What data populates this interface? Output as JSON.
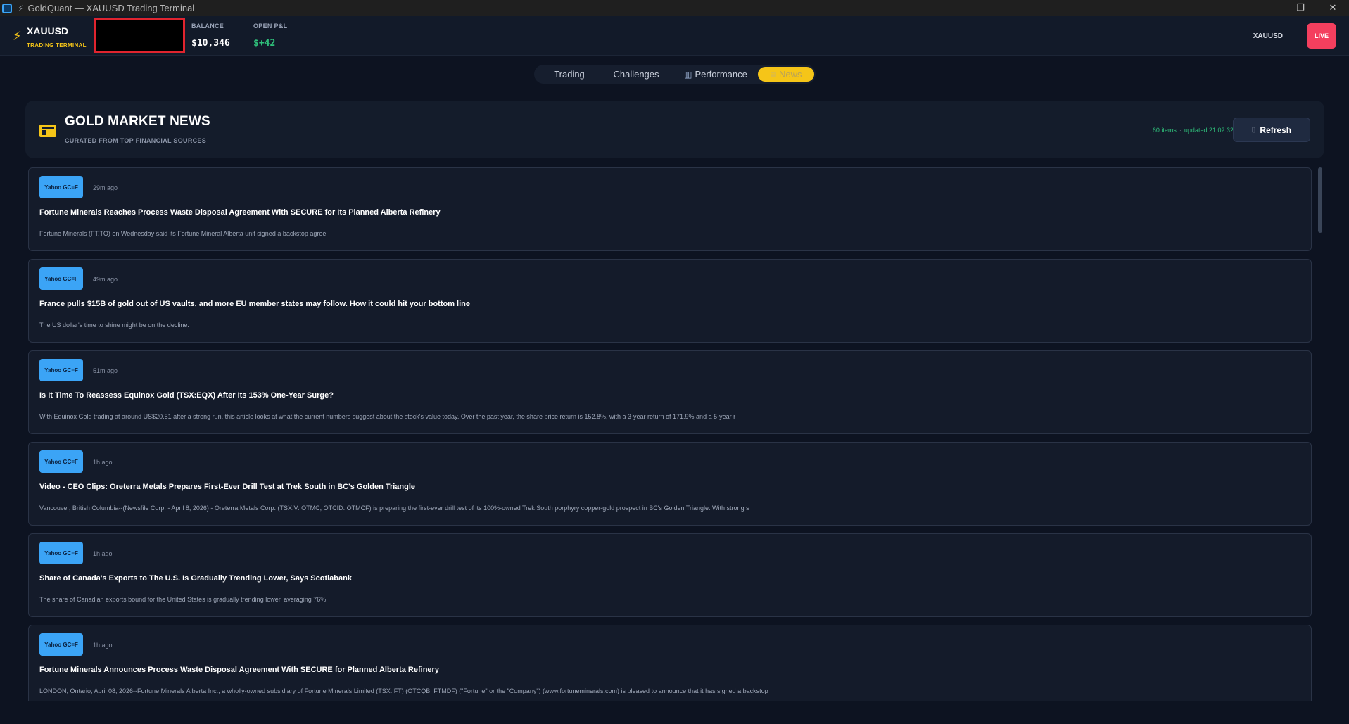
{
  "window": {
    "title": "GoldQuant — XAUUSD Trading Terminal",
    "controls": [
      "—",
      "❐",
      "✕"
    ]
  },
  "header": {
    "symbol": "XAUUSD",
    "subtitle": "TRADING TERMINAL",
    "balance_label": "BALANCE",
    "balance_value": "$10,346",
    "pnl_label": "OPEN P&L",
    "pnl_value": "$+42",
    "right_symbol": "XAUUSD",
    "live_label": "LIVE",
    "colors": {
      "accent": "#f5c518",
      "positive": "#2fbf7a",
      "live": "#f43f5e"
    }
  },
  "tabs": [
    {
      "label": "Trading",
      "icon": ""
    },
    {
      "label": "Challenges",
      "icon": ""
    },
    {
      "label": "Performance",
      "icon": "bar-chart-icon"
    },
    {
      "label": "News",
      "icon": "newspaper-icon",
      "active": true
    }
  ],
  "news_panel": {
    "title": "GOLD MARKET NEWS",
    "subtitle": "CURATED FROM TOP FINANCIAL SOURCES",
    "count": "60 items",
    "updated": "updated 21:02:32",
    "refresh_label": "Refresh"
  },
  "news": [
    {
      "source": "Yahoo GC=F",
      "time": "29m ago",
      "headline": "Fortune Minerals Reaches Process Waste Disposal Agreement With SECURE for Its Planned Alberta Refinery",
      "summary": "Fortune Minerals (FT.TO) on Wednesday said its Fortune Mineral Alberta unit signed a backstop agree"
    },
    {
      "source": "Yahoo GC=F",
      "time": "49m ago",
      "headline": "France pulls $15B of gold out of US vaults, and more EU member states may follow. How it could hit your bottom line",
      "summary": "The US dollar's time to shine might be on the decline."
    },
    {
      "source": "Yahoo GC=F",
      "time": "51m ago",
      "headline": "Is It Time To Reassess Equinox Gold (TSX:EQX) After Its 153% One-Year Surge?",
      "summary": "With Equinox Gold trading at around US$20.51 after a strong run, this article looks at what the current numbers suggest about the stock's value today. Over the past year, the share price return is 152.8%, with a 3-year return of 171.9% and a 5-year r"
    },
    {
      "source": "Yahoo GC=F",
      "time": "1h ago",
      "headline": "Video - CEO Clips: Oreterra Metals Prepares First-Ever Drill Test at Trek South in BC's Golden Triangle",
      "summary": "Vancouver, British Columbia--(Newsfile Corp. - April 8, 2026) - Oreterra Metals Corp. (TSX.V: OTMC, OTCID: OTMCF) is preparing the first-ever drill test of its 100%-owned Trek South porphyry copper-gold prospect in BC's Golden Triangle. With strong s"
    },
    {
      "source": "Yahoo GC=F",
      "time": "1h ago",
      "headline": "Share of Canada's Exports to The U.S. Is Gradually Trending Lower, Says Scotiabank",
      "summary": "The share of Canadian exports bound for the United States is gradually trending lower, averaging 76%"
    },
    {
      "source": "Yahoo GC=F",
      "time": "1h ago",
      "headline": "Fortune Minerals Announces Process Waste Disposal Agreement With SECURE for Planned Alberta Refinery",
      "summary": "LONDON, Ontario, April 08, 2026--Fortune Minerals Alberta Inc., a wholly-owned subsidiary of Fortune Minerals Limited (TSX: FT) (OTCQB: FTMDF) (\"Fortune\" or the \"Company\") (www.fortuneminerals.com) is pleased to announce that it has signed a backstop"
    }
  ]
}
